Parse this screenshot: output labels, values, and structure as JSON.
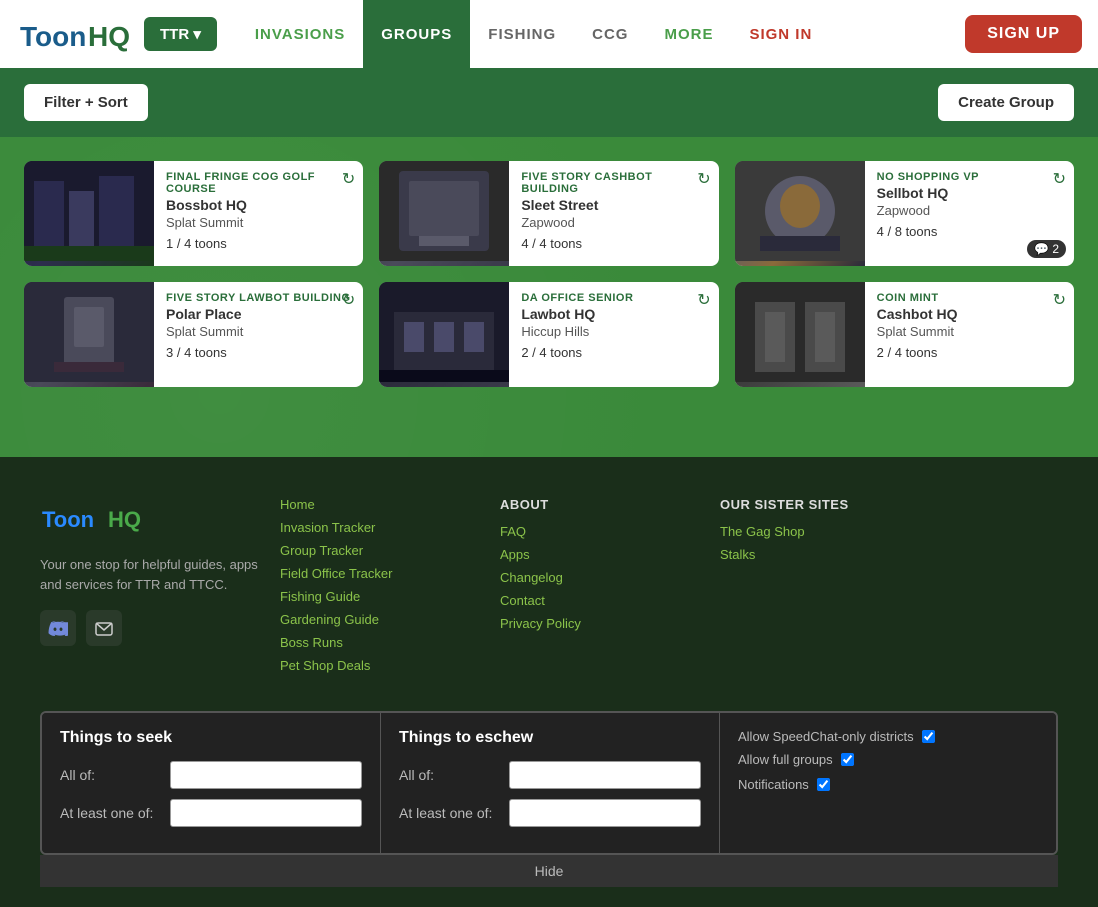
{
  "header": {
    "logo_text": "ToonHQ",
    "ttr_label": "TTR ▾",
    "nav": [
      {
        "id": "invasions",
        "label": "INVASIONS",
        "active": false
      },
      {
        "id": "groups",
        "label": "GROUPS",
        "active": true
      },
      {
        "id": "fishing",
        "label": "FISHING",
        "active": false
      },
      {
        "id": "ccg",
        "label": "CCG",
        "active": false
      },
      {
        "id": "more",
        "label": "MORE",
        "active": false
      },
      {
        "id": "signin",
        "label": "SIGN IN",
        "active": false
      }
    ],
    "signup_label": "SIGN UP"
  },
  "toolbar": {
    "filter_label": "Filter + Sort",
    "create_group_label": "Create Group"
  },
  "cards": [
    {
      "id": "card1",
      "title": "FINAL FRINGE COG GOLF COURSE",
      "location1": "Bossbot HQ",
      "location2": "Splat Summit",
      "toons": "1 / 4 toons",
      "thumb_class": "thumb-final-fringe",
      "has_refresh": true,
      "chat_badge": null
    },
    {
      "id": "card2",
      "title": "FIVE STORY CASHBOT BUILDING",
      "location1": "Sleet Street",
      "location2": "Zapwood",
      "toons": "4 / 4 toons",
      "thumb_class": "thumb-cashbot",
      "has_refresh": true,
      "chat_badge": null
    },
    {
      "id": "card3",
      "title": "NO SHOPPING VP",
      "location1": "Sellbot HQ",
      "location2": "Zapwood",
      "toons": "4 / 8 toons",
      "thumb_class": "thumb-noshop",
      "has_refresh": true,
      "chat_badge": "2"
    },
    {
      "id": "card4",
      "title": "FIVE STORY LAWBOT BUILDING",
      "location1": "Polar Place",
      "location2": "Splat Summit",
      "toons": "3 / 4 toons",
      "thumb_class": "thumb-lawbot",
      "has_refresh": true,
      "chat_badge": null
    },
    {
      "id": "card5",
      "title": "DA OFFICE SENIOR",
      "location1": "Lawbot HQ",
      "location2": "Hiccup Hills",
      "toons": "2 / 4 toons",
      "thumb_class": "thumb-daoffice",
      "has_refresh": true,
      "chat_badge": null
    },
    {
      "id": "card6",
      "title": "COIN MINT",
      "location1": "Cashbot HQ",
      "location2": "Splat Summit",
      "toons": "2 / 4 toons",
      "thumb_class": "thumb-coinmint",
      "has_refresh": true,
      "chat_badge": null
    }
  ],
  "footer": {
    "logo": "ToonHQ",
    "desc": "Your one stop for helpful guides, apps and services for TTR and TTCC.",
    "col1_links": [
      {
        "label": "Home"
      },
      {
        "label": "Invasion Tracker"
      },
      {
        "label": "Group Tracker"
      },
      {
        "label": "Field Office Tracker"
      },
      {
        "label": "Fishing Guide"
      },
      {
        "label": "Gardening Guide"
      },
      {
        "label": "Boss Runs"
      },
      {
        "label": "Pet Shop Deals"
      }
    ],
    "col2_title": "ABOUT",
    "col2_links": [
      {
        "label": "FAQ"
      },
      {
        "label": "Apps"
      },
      {
        "label": "Changelog"
      },
      {
        "label": "Contact"
      },
      {
        "label": "Privacy Policy"
      }
    ],
    "col3_title": "OUR SISTER SITES",
    "col3_links": [
      {
        "label": "The Gag Shop"
      },
      {
        "label": "Stalks"
      }
    ]
  },
  "filter_panel": {
    "seek_title": "Things to seek",
    "seek_all_label": "All of:",
    "seek_all_placeholder": "",
    "seek_atleast_label": "At least one of:",
    "seek_atleast_placeholder": "",
    "eschew_title": "Things to eschew",
    "eschew_all_label": "All of:",
    "eschew_all_placeholder": "",
    "eschew_atleast_label": "At least one of:",
    "eschew_atleast_placeholder": "",
    "speedchat_label": "Allow SpeedChat-only districts",
    "fullgroups_label": "Allow full groups",
    "notifications_label": "Notifications",
    "hide_label": "Hide"
  }
}
